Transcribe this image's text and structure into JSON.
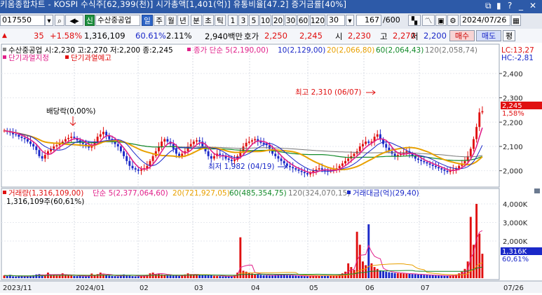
{
  "title": "키움종합차트 - KOSPI 수식주[62,399(천)] 시가총액[1,401(억)] 유통비율[47.2] 증거금률[40%]",
  "toolbar": {
    "code": "017550",
    "stock_name": "수산중공업",
    "periods": [
      "일",
      "주",
      "월",
      "년",
      "분",
      "초",
      "틱"
    ],
    "intervals": [
      "1",
      "3",
      "5",
      "10",
      "20",
      "30",
      "60",
      "120",
      "30"
    ],
    "count": "167",
    "total": "/600",
    "date": "2024/07/26"
  },
  "quote": {
    "change": "35",
    "change_pct": "+1.58%",
    "volume": "1,316,109",
    "vol_ratio": "60.61%",
    "turnover": "2.11%",
    "amount": "2,940백만",
    "hoga_label": "호가",
    "hoga_buy": "2,250",
    "hoga_sell": "2,245",
    "open_label": "시",
    "open": "2,230",
    "high_label": "고",
    "high": "2,270",
    "low_label": "저",
    "low": "2,200",
    "buy_btn": "매수",
    "sell_btn": "매도",
    "eval_btn": "평"
  },
  "price_panel": {
    "header": "수산중공업 시:2,230 고:2,270 저:2,200 종:2,245",
    "ma_label": "종가 단순 5(2,190,00)",
    "ma10": "10(2,129,00)",
    "ma20": "20(2,066,80)",
    "ma60": "60(2,064,43)",
    "ma120": "120(2,058,74)",
    "warn1": "단기과열지정",
    "warn2": "단기과열예고",
    "lc": "LC:13,27",
    "hc": "HC:-2,81",
    "high_annot": "최고 2,310 (06/07)",
    "low_annot": "최저 1,982 (04/19)",
    "dividend": "배당락(0,00%)",
    "cur_price": "2,245",
    "cur_pct": "1,58%"
  },
  "volume_panel": {
    "header": "거래량(1,316,109,00)",
    "ma5": "단순 5(2,377,064,60)",
    "ma20": "20(721,927,05)",
    "ma60": "60(485,354,75)",
    "ma120": "120(324,070,15)",
    "amount": "거래대금(억)(29,40)",
    "sub": "1,316,109주(60,61%)",
    "cur_vol": "1,316K",
    "cur_pct": "60,61%"
  },
  "x_labels": [
    "2023/11",
    "2024/01",
    "02",
    "03",
    "04",
    "05",
    "06",
    "07",
    "07/26"
  ],
  "y_price_labels": [
    "2,400",
    "2,300",
    "2,200",
    "2,100",
    "2,000"
  ],
  "y_vol_labels": [
    "4,000K",
    "3,000K",
    "2,000K"
  ],
  "colors": {
    "up": "#e01010",
    "down": "#1a28c8",
    "ma5": "#e0208a",
    "ma10": "#1a28c8",
    "ma20": "#e8a000",
    "ma60": "#138a2a",
    "ma120": "#777777"
  },
  "chart_data": {
    "type": "candlestick",
    "y_range_price": [
      1950,
      2440
    ],
    "y_range_volume": [
      0,
      4300000
    ],
    "closes": [
      2165,
      2160,
      2158,
      2150,
      2148,
      2140,
      2135,
      2130,
      2120,
      2110,
      2100,
      2085,
      2060,
      2050,
      2065,
      2080,
      2090,
      2100,
      2105,
      2110,
      2120,
      2130,
      2135,
      2140,
      2135,
      2125,
      2115,
      2110,
      2100,
      2095,
      2105,
      2120,
      2140,
      2150,
      2160,
      2145,
      2130,
      2120,
      2110,
      2100,
      2080,
      2060,
      2040,
      2020,
      2010,
      2005,
      2000,
      2005,
      2010,
      2020,
      2040,
      2060,
      2080,
      2100,
      2120,
      2130,
      2120,
      2110,
      2090,
      2070,
      2060,
      2070,
      2080,
      2100,
      2110,
      2120,
      2125,
      2120,
      2100,
      2080,
      2060,
      2050,
      2060,
      2070,
      2065,
      2060,
      2050,
      2045,
      2040,
      2045,
      2060,
      2080,
      2100,
      2115,
      2120,
      2125,
      2130,
      2120,
      2115,
      2110,
      2105,
      2090,
      2070,
      2060,
      2050,
      2040,
      2030,
      2020,
      2015,
      2010,
      2005,
      2000,
      1995,
      1990,
      1985,
      1990,
      2000,
      2005,
      2010,
      2005,
      2000,
      1998,
      2000,
      2005,
      2010,
      2020,
      2030,
      2040,
      2050,
      2060,
      2070,
      2080,
      2100,
      2110,
      2120,
      2115,
      2120,
      2140,
      2150,
      2130,
      2110,
      2095,
      2080,
      2070,
      2060,
      2065,
      2070,
      2075,
      2080,
      2070,
      2060,
      2050,
      2045,
      2040,
      2035,
      2030,
      2025,
      2020,
      2015,
      2010,
      2005,
      2000,
      1995,
      2000,
      2005,
      2010,
      2020,
      2030,
      2040,
      2060,
      2090,
      2130,
      2180,
      2240,
      2245
    ],
    "volumes": [
      150000,
      120000,
      180000,
      100000,
      90000,
      110000,
      130000,
      95000,
      105000,
      140000,
      160000,
      200000,
      220000,
      160000,
      130000,
      300000,
      180000,
      200000,
      170000,
      150000,
      260000,
      190000,
      150000,
      140000,
      120000,
      110000,
      130000,
      100000,
      90000,
      120000,
      250000,
      180000,
      220000,
      300000,
      200000,
      160000,
      140000,
      120000,
      110000,
      100000,
      180000,
      200000,
      150000,
      130000,
      110000,
      100000,
      95000,
      120000,
      140000,
      180000,
      260000,
      300000,
      220000,
      250000,
      200000,
      180000,
      160000,
      150000,
      140000,
      130000,
      120000,
      150000,
      200000,
      260000,
      220000,
      180000,
      160000,
      150000,
      170000,
      200000,
      180000,
      150000,
      130000,
      120000,
      110000,
      100000,
      95000,
      100000,
      110000,
      150000,
      300000,
      2200000,
      400000,
      350000,
      300000,
      250000,
      220000,
      200000,
      180000,
      160000,
      150000,
      140000,
      150000,
      180000,
      220000,
      200000,
      180000,
      160000,
      150000,
      140000,
      130000,
      125000,
      120000,
      110000,
      105000,
      115000,
      130000,
      140000,
      150000,
      145000,
      140000,
      130000,
      135000,
      140000,
      160000,
      200000,
      260000,
      350000,
      800000,
      600000,
      450000,
      2500000,
      1800000,
      900000,
      700000,
      2900000,
      800000,
      600000,
      500000,
      420000,
      380000,
      350000,
      320000,
      300000,
      280000,
      270000,
      260000,
      250000,
      240000,
      230000,
      220000,
      210000,
      200000,
      190000,
      180000,
      170000,
      160000,
      150000,
      145000,
      140000,
      135000,
      130000,
      130000,
      140000,
      160000,
      200000,
      260000,
      350000,
      500000,
      900000,
      3300000,
      1800000,
      4000000,
      2400000,
      1316109
    ]
  }
}
